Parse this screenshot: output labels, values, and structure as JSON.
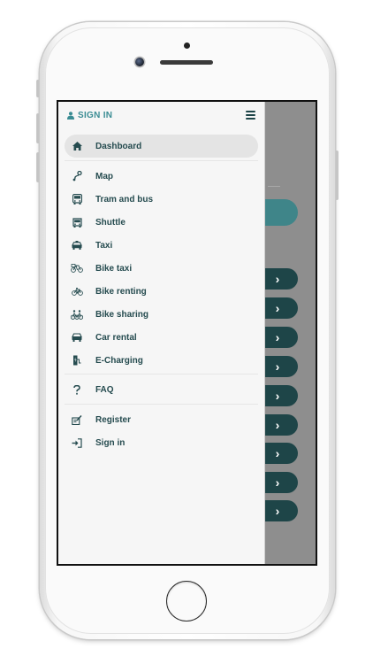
{
  "drawer": {
    "signin_label": "SIGN IN",
    "items": [
      {
        "label": "Dashboard",
        "icon": "home-icon",
        "active": true
      },
      {
        "label": "Map",
        "icon": "map-route-icon"
      },
      {
        "label": "Tram and bus",
        "icon": "bus-icon"
      },
      {
        "label": "Shuttle",
        "icon": "shuttle-icon"
      },
      {
        "label": "Taxi",
        "icon": "taxi-icon"
      },
      {
        "label": "Bike taxi",
        "icon": "bike-taxi-icon"
      },
      {
        "label": "Bike renting",
        "icon": "bike-icon"
      },
      {
        "label": "Bike sharing",
        "icon": "bike-sharing-icon"
      },
      {
        "label": "Car rental",
        "icon": "car-icon"
      },
      {
        "label": "E-Charging",
        "icon": "charging-icon"
      },
      {
        "label": "FAQ",
        "icon": "question-icon"
      },
      {
        "label": "Register",
        "icon": "register-icon"
      },
      {
        "label": "Sign in",
        "icon": "sign-in-icon"
      }
    ]
  },
  "background_buttons": {
    "glyph": "›",
    "count": 9
  },
  "colors": {
    "accent": "#3a8c93",
    "text_dark": "#254b4f",
    "dim_overlay": "#8e8e8e",
    "button_dark": "#1e4548"
  }
}
